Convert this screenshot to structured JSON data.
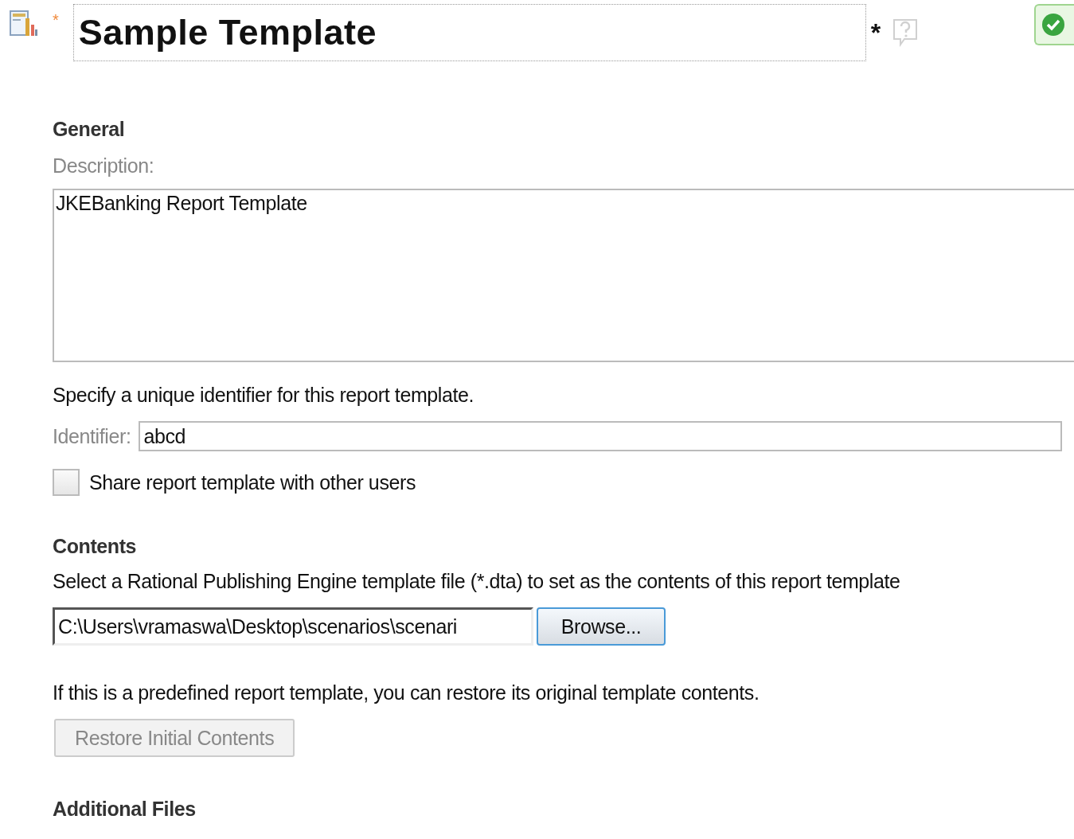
{
  "header": {
    "required_mark": "*",
    "title": "Sample Template",
    "title_required_mark": "*"
  },
  "general": {
    "heading": "General",
    "description_label": "Description:",
    "description": "JKEBanking Report Template",
    "identifier_hint": "Specify a unique identifier for this report template.",
    "identifier_label": "Identifier:",
    "identifier": "abcd",
    "share": {
      "label": "Share report template with other users",
      "checked": false
    }
  },
  "contents": {
    "heading": "Contents",
    "instructions": "Select a Rational Publishing Engine template file (*.dta) to set as the contents of this report template",
    "file_path": "C:\\Users\\vramaswa\\Desktop\\scenarios\\scenari",
    "browse_button": "Browse...",
    "restore_hint": "If this is a predefined report template, you can restore its original template contents.",
    "restore_button": {
      "label": "Restore Initial Contents",
      "disabled": true
    }
  },
  "additional_files": {
    "heading": "Additional Files"
  }
}
